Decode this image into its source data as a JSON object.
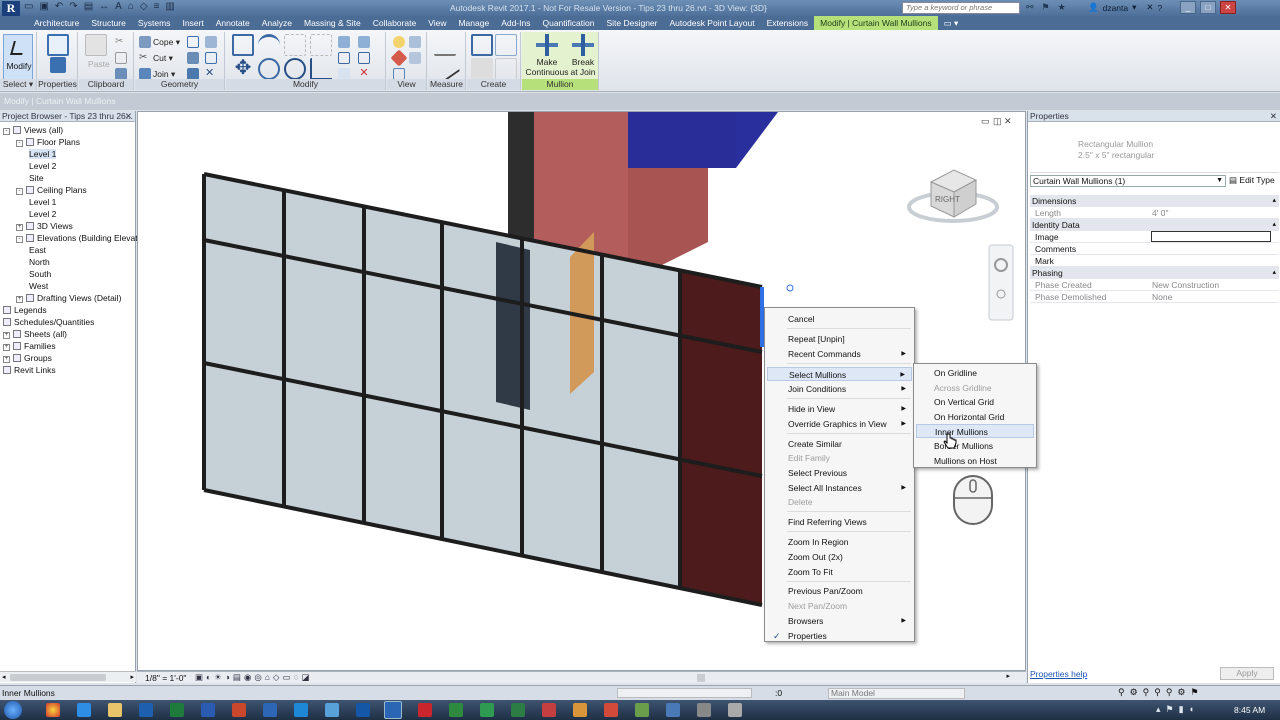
{
  "app": {
    "title": "Autodesk Revit 2017.1 - Not For Resale Version -   Tips 23 thru 26.rvt - 3D View: {3D}",
    "logo_letter": "R",
    "search_placeholder": "Type a keyword or phrase",
    "user": "dzanta"
  },
  "ribbon_tabs": [
    "Architecture",
    "Structure",
    "Systems",
    "Insert",
    "Annotate",
    "Analyze",
    "Massing & Site",
    "Collaborate",
    "View",
    "Manage",
    "Add-Ins",
    "Quantification",
    "Site Designer",
    "Autodesk Point Layout",
    "Extensions",
    "Modify | Curtain Wall Mullions"
  ],
  "ribbon": {
    "modify_label": "Modify",
    "paste_label": "Paste",
    "cope_label": "Cope",
    "cut_label": "Cut",
    "join_label": "Join",
    "groups": {
      "select": "Select",
      "properties": "Properties",
      "clipboard": "Clipboard",
      "geometry": "Geometry",
      "modify": "Modify",
      "view": "View",
      "measure": "Measure",
      "create": "Create",
      "mullion": "Mullion"
    },
    "make_continuous_1": "Make",
    "make_continuous_2": "Continuous",
    "break_at_join_1": "Break",
    "break_at_join_2": "at Join"
  },
  "context_bar": "Modify | Curtain Wall Mullions",
  "project_browser": {
    "title": "Project Browser - Tips 23 thru 26...",
    "items": [
      {
        "label": "Views (all)",
        "level": 0,
        "exp": "-"
      },
      {
        "label": "Floor Plans",
        "level": 1,
        "exp": "-"
      },
      {
        "label": "Level 1",
        "level": 2,
        "exp": ""
      },
      {
        "label": "Level 2",
        "level": 2,
        "exp": ""
      },
      {
        "label": "Site",
        "level": 2,
        "exp": ""
      },
      {
        "label": "Ceiling Plans",
        "level": 1,
        "exp": "-"
      },
      {
        "label": "Level 1",
        "level": 2,
        "exp": ""
      },
      {
        "label": "Level 2",
        "level": 2,
        "exp": ""
      },
      {
        "label": "3D Views",
        "level": 1,
        "exp": "+"
      },
      {
        "label": "Elevations (Building Elevation)",
        "level": 1,
        "exp": "-"
      },
      {
        "label": "East",
        "level": 2,
        "exp": ""
      },
      {
        "label": "North",
        "level": 2,
        "exp": ""
      },
      {
        "label": "South",
        "level": 2,
        "exp": ""
      },
      {
        "label": "West",
        "level": 2,
        "exp": ""
      },
      {
        "label": "Drafting Views (Detail)",
        "level": 1,
        "exp": "+"
      },
      {
        "label": "Legends",
        "level": 0,
        "exp": ""
      },
      {
        "label": "Schedules/Quantities",
        "level": 0,
        "exp": ""
      },
      {
        "label": "Sheets (all)",
        "level": 0,
        "exp": "+"
      },
      {
        "label": "Families",
        "level": 0,
        "exp": "+"
      },
      {
        "label": "Groups",
        "level": 0,
        "exp": "+"
      },
      {
        "label": "Revit Links",
        "level": 0,
        "exp": ""
      }
    ]
  },
  "view": {
    "viewcube_label": "RIGHT",
    "scale": "1/8\" = 1'-0\""
  },
  "context_menu": {
    "items": [
      "Cancel",
      "Repeat [Unpin]",
      "Recent Commands",
      "Select Mullions",
      "Join Conditions",
      "Hide in View",
      "Override Graphics in View",
      "Create Similar",
      "Edit Family",
      "Select Previous",
      "Select All Instances",
      "Delete",
      "Find Referring Views",
      "Zoom In Region",
      "Zoom Out (2x)",
      "Zoom To Fit",
      "Previous Pan/Zoom",
      "Next Pan/Zoom",
      "Browsers",
      "Properties"
    ],
    "check_mark": "✓"
  },
  "submenu": {
    "items": [
      "On Gridline",
      "Across Gridline",
      "On Vertical Grid",
      "On Horizontal Grid",
      "Inner Mullions",
      "Border Mullions",
      "Mullions on Host"
    ]
  },
  "properties": {
    "title": "Properties",
    "type_name": "Rectangular Mullion",
    "type_sub": "2.5\" x 5\" rectangular",
    "selector": "Curtain Wall Mullions (1)",
    "edit_type": "Edit Type",
    "rows": [
      {
        "k": "Dimensions",
        "v": "",
        "sec": true
      },
      {
        "k": "Length",
        "v": "4'  0\"",
        "dim": true
      },
      {
        "k": "Identity Data",
        "v": "",
        "sec": true
      },
      {
        "k": "Image",
        "v": ""
      },
      {
        "k": "Comments",
        "v": ""
      },
      {
        "k": "Mark",
        "v": ""
      },
      {
        "k": "Phasing",
        "v": "",
        "sec": true
      },
      {
        "k": "Phase Created",
        "v": "New Construction",
        "dim": true
      },
      {
        "k": "Phase Demolished",
        "v": "None",
        "dim": true
      }
    ],
    "help_link": "Properties help",
    "apply": "Apply"
  },
  "status": {
    "text": "Inner Mullions",
    "zero": ":0",
    "model": "Main Model"
  },
  "taskbar": {
    "time": "8:45 AM"
  }
}
